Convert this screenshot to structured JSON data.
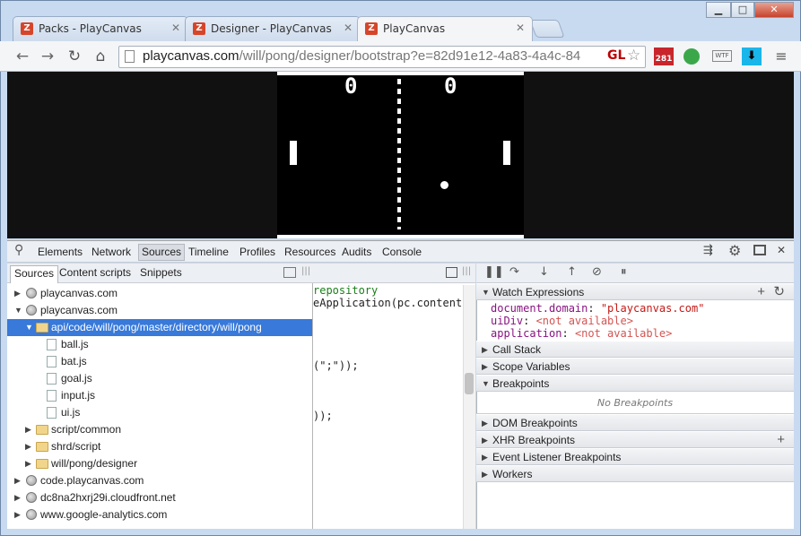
{
  "tabs": [
    {
      "title": "Packs - PlayCanvas"
    },
    {
      "title": "Designer - PlayCanvas"
    },
    {
      "title": "PlayCanvas"
    }
  ],
  "window_buttons": {
    "minimize": "▁",
    "maximize": "□",
    "close": "✕"
  },
  "omnibox": {
    "domain": "playcanvas.com",
    "path": "/will/pong/designer/bootstrap?e=82d91e12-4a83-4a4c-84"
  },
  "extensions": {
    "gl": "GL",
    "gmail_count": "281",
    "wtf": "WTF"
  },
  "game": {
    "score_left": "0",
    "score_right": "0"
  },
  "devtools": {
    "tabs": [
      "Elements",
      "Network",
      "Sources",
      "Timeline",
      "Profiles",
      "Resources",
      "Audits",
      "Console"
    ],
    "selected_tab": "Sources",
    "subtabs": [
      "Sources",
      "Content scripts",
      "Snippets"
    ],
    "tree": [
      {
        "label": "playcanvas.com"
      },
      {
        "label": "playcanvas.com"
      },
      {
        "label": "api/code/will/pong/master/directory/will/pong"
      },
      {
        "label": "ball.js"
      },
      {
        "label": "bat.js"
      },
      {
        "label": "goal.js"
      },
      {
        "label": "input.js"
      },
      {
        "label": "ui.js"
      },
      {
        "label": "script/common"
      },
      {
        "label": "shrd/script"
      },
      {
        "label": "will/pong/designer"
      },
      {
        "label": "code.playcanvas.com"
      },
      {
        "label": "dc8na2hxrj29i.cloudfront.net"
      },
      {
        "label": "www.google-analytics.com"
      }
    ],
    "code_lines": [
      "repository",
      "eApplication(pc.content)",
      "(\";\"));",
      "));"
    ],
    "panes": {
      "watch": "Watch Expressions",
      "call_stack": "Call Stack",
      "scope": "Scope Variables",
      "breakpoints": "Breakpoints",
      "no_breakpoints": "No Breakpoints",
      "dom_bp": "DOM Breakpoints",
      "xhr_bp": "XHR Breakpoints",
      "event_bp": "Event Listener Breakpoints",
      "workers": "Workers"
    },
    "watch_expressions": [
      {
        "name": "document.domain",
        "value": "\"playcanvas.com\""
      },
      {
        "name": "uiDiv",
        "value": "<not available>"
      },
      {
        "name": "application",
        "value": "<not available>"
      }
    ]
  }
}
